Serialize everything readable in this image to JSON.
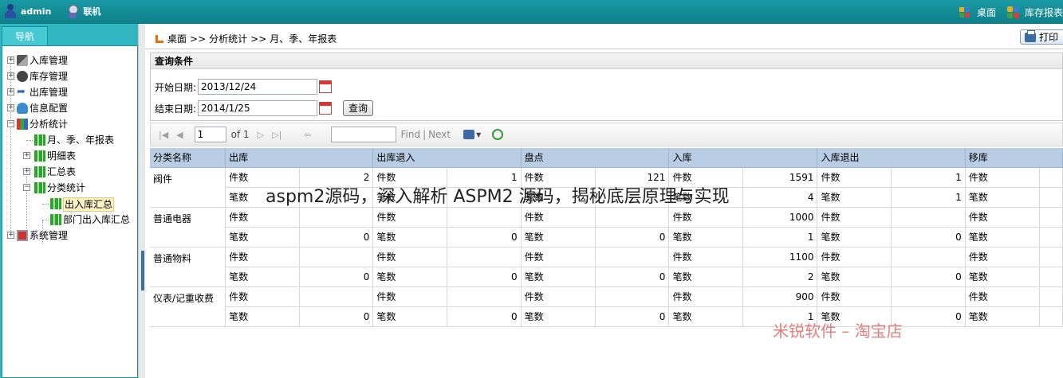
{
  "topbar": {
    "user": "admin",
    "status": "联机",
    "desk_link": "桌面",
    "report_link": "库存报表"
  },
  "nav": {
    "tab": "导航",
    "items": [
      {
        "label": "入库管理",
        "icon": "inbound-icon"
      },
      {
        "label": "库存管理",
        "icon": "inventory-icon"
      },
      {
        "label": "出库管理",
        "icon": "outbound-icon"
      },
      {
        "label": "信息配置",
        "icon": "config-icon"
      },
      {
        "label": "分析统计",
        "icon": "chart-icon"
      },
      {
        "label": "月、季、年报表",
        "icon": "report-icon"
      },
      {
        "label": "明细表",
        "icon": "report-icon"
      },
      {
        "label": "汇总表",
        "icon": "report-icon"
      },
      {
        "label": "分类统计",
        "icon": "report-icon"
      },
      {
        "label": "出入库汇总",
        "icon": "report-icon"
      },
      {
        "label": "部门出入库汇总",
        "icon": "report-icon"
      },
      {
        "label": "系统管理",
        "icon": "system-icon"
      }
    ]
  },
  "breadcrumb": {
    "home": "桌面",
    "sep": ">>",
    "section": "分析统计",
    "page": "月、季、年报表"
  },
  "toolbar": {
    "print": "打印"
  },
  "query": {
    "title": "查询条件",
    "start_label": "开始日期:",
    "start_value": "2013/12/24",
    "end_label": "结束日期:",
    "end_value": "2014/1/25",
    "search_button": "查询"
  },
  "pager": {
    "page": "1",
    "of": "of 1",
    "find": "Find",
    "divider": "|",
    "next": "Next"
  },
  "table": {
    "headers": [
      "分类名称",
      "出库",
      "出库退入",
      "盘点",
      "入库",
      "入库退出",
      "移库"
    ],
    "row_labels": {
      "count": "件数",
      "times": "笔数"
    },
    "groups": [
      {
        "name": "阀件",
        "count_vals": [
          "2",
          "1",
          "121",
          "1591",
          "1",
          ""
        ],
        "times_vals": [
          "",
          "",
          "",
          "4",
          "1",
          ""
        ]
      },
      {
        "name": "普通电器",
        "count_vals": [
          "",
          "",
          "",
          "1000",
          "",
          ""
        ],
        "times_vals": [
          "0",
          "0",
          "0",
          "1",
          "0",
          ""
        ]
      },
      {
        "name": "普通物料",
        "count_vals": [
          "",
          "",
          "",
          "1100",
          "",
          ""
        ],
        "times_vals": [
          "0",
          "0",
          "0",
          "2",
          "0",
          ""
        ]
      },
      {
        "name": "仪表/记重收费",
        "count_vals": [
          "",
          "",
          "",
          "900",
          "",
          ""
        ],
        "times_vals": [
          "0",
          "0",
          "0",
          "1",
          "0",
          ""
        ]
      }
    ]
  },
  "watermark": {
    "title": "aspm2源码，深入解析 ASPM2 源码，揭秘底层原理与实现",
    "shop": "米锐软件 – 淘宝店"
  }
}
